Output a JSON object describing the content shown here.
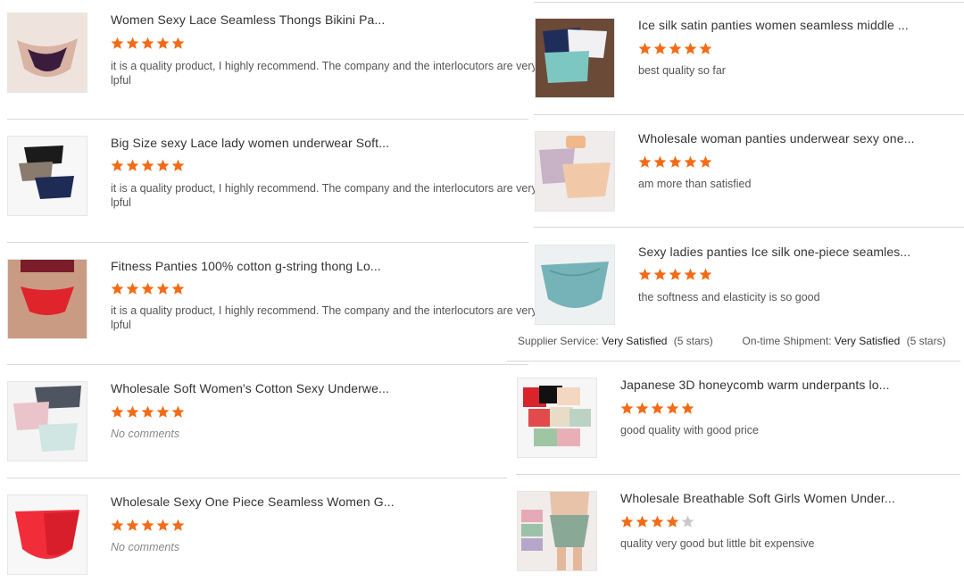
{
  "colors": {
    "star_on": "#f36b16",
    "star_off": "#c9c9c9"
  },
  "left_reviews": [
    {
      "title": "Women Sexy Lace Seamless Thongs Bikini Pa...",
      "rating": 5,
      "comment_line1": "it is a quality product, I highly recommend. The company and the interlocutors are very",
      "comment_line2": "lpful"
    },
    {
      "title": "Big Size sexy Lace lady women underwear Soft...",
      "rating": 5,
      "comment_line1": "it is a quality product, I highly recommend. The company and the interlocutors are very",
      "comment_line2": "lpful"
    },
    {
      "title": "Fitness Panties 100% cotton g-string thong Lo...",
      "rating": 5,
      "comment_line1": "it is a quality product, I highly recommend. The company and the interlocutors are very",
      "comment_line2": "lpful"
    },
    {
      "title": "Wholesale Soft Women's Cotton Sexy Underwe...",
      "rating": 5,
      "comment_line1": "No comments",
      "comment_line2": ""
    },
    {
      "title": "Wholesale Sexy One Piece Seamless Women G...",
      "rating": 5,
      "comment_line1": "No comments",
      "comment_line2": ""
    }
  ],
  "right_reviews": [
    {
      "title": "Ice silk satin panties women seamless middle ...",
      "rating": 5,
      "comment": "best quality so far"
    },
    {
      "title": "Wholesale woman panties underwear sexy one...",
      "rating": 5,
      "comment": "am more than satisfied"
    },
    {
      "title": "Sexy ladies panties Ice silk one-piece seamles...",
      "rating": 5,
      "comment": "the softness and elasticity is so good"
    }
  ],
  "supplier_summary": {
    "service_label": "Supplier Service:",
    "service_value": "Very Satisfied",
    "service_stars": "(5 stars)",
    "shipment_label": "On-time Shipment:",
    "shipment_value": "Very Satisfied",
    "shipment_stars": "(5 stars)"
  },
  "lower_right_reviews": [
    {
      "title": "Japanese 3D honeycomb warm underpants lo...",
      "rating": 5,
      "comment": "good quality with good price"
    },
    {
      "title": "Wholesale Breathable Soft Girls Women Under...",
      "rating": 4,
      "comment": "quality very good but little bit expensive"
    }
  ]
}
